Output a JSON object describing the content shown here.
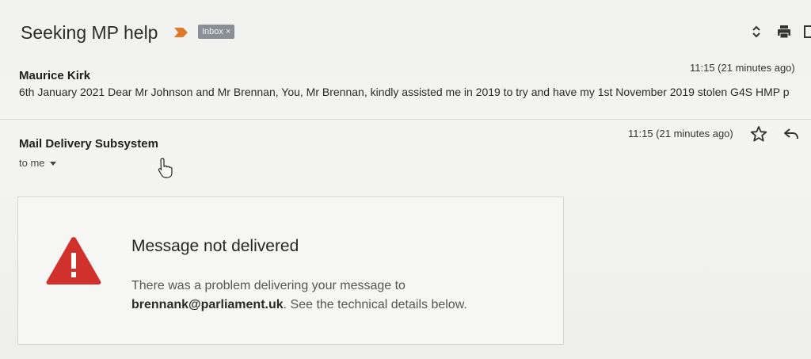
{
  "header": {
    "subject": "Seeking MP help",
    "label": "Inbox",
    "label_remove": "×"
  },
  "thread": [
    {
      "sender": "Maurice Kirk",
      "time": "11:15 (21 minutes ago)",
      "snippet": "6th January 2021 Dear Mr Johnson and Mr Brennan, You, Mr Brennan, kindly assisted me in 2019 to try and have my 1st November 2019 stolen G4S HMP p"
    }
  ],
  "message": {
    "sender": "Mail Delivery Subsystem",
    "recipient": "to me",
    "time": "11:15 (21 minutes ago)"
  },
  "bounce": {
    "title": "Message not delivered",
    "text_before": "There was a problem delivering your message to",
    "address": "brennank@parliament.uk",
    "text_after": ". See the technical details below."
  },
  "icons": {
    "importance": "importance-marker-icon",
    "expand": "expand-all-icon",
    "print": "print-icon",
    "popout": "new-window-icon",
    "star": "star-icon",
    "reply": "reply-icon",
    "warning": "warning-icon",
    "cursor": "hand-cursor-icon"
  },
  "colors": {
    "importance": "#e0782a",
    "label_chip": "#8a8f96",
    "warning": "#d0312d"
  }
}
